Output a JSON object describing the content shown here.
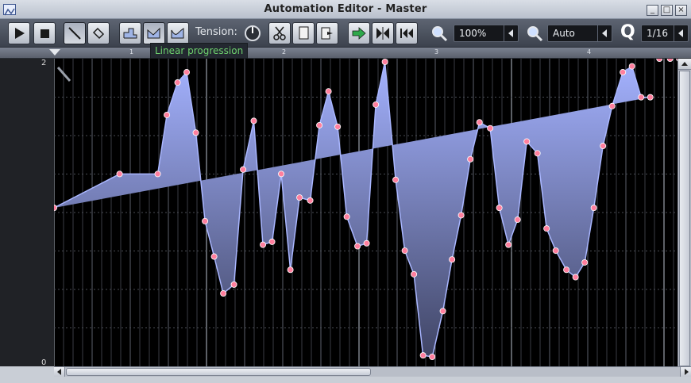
{
  "window": {
    "title": "Automation Editor - Master"
  },
  "toolbar": {
    "tension_label": "Tension:",
    "zoom_x": "100%",
    "zoom_y": "Auto",
    "quantization": "1/16",
    "quantization_icon_label": "Q",
    "buttons": [
      "play-icon",
      "stop-icon",
      "pencil-icon",
      "eraser-icon",
      "discrete-progression-icon",
      "linear-progression-icon",
      "cubic-hermite-progression-icon",
      "tension-knob-icon",
      "cut-icon",
      "copy-icon",
      "paste-icon",
      "playback-arrow-icon",
      "flip-icon",
      "rewind-icon",
      "zoom-x-icon",
      "zoom-y-icon"
    ]
  },
  "tooltip": {
    "text": "Linear progression"
  },
  "ruler": {
    "bars": [
      "1",
      "2",
      "3",
      "4"
    ]
  },
  "scale": {
    "max": "2",
    "min": "0"
  },
  "colors": {
    "background": "#000000",
    "fill_top": "#a4b2ff",
    "fill_bottom": "#404565",
    "line": "#a9b6ff",
    "point": "#ff7f9e"
  },
  "chart_data": {
    "type": "area",
    "xlabel": "",
    "ylabel": "",
    "ylim": [
      0,
      2
    ],
    "x": [
      0.0,
      0.43,
      0.68,
      0.74,
      0.81,
      0.87,
      0.93,
      0.99,
      1.05,
      1.11,
      1.18,
      1.24,
      1.31,
      1.37,
      1.43,
      1.49,
      1.55,
      1.61,
      1.68,
      1.74,
      1.8,
      1.86,
      1.92,
      1.99,
      2.05,
      2.11,
      2.17,
      2.24,
      2.3,
      2.36,
      2.42,
      2.48,
      2.55,
      2.61,
      2.67,
      2.73,
      2.79,
      2.86,
      2.92,
      2.98,
      3.04,
      3.1,
      3.17,
      3.23,
      3.29,
      3.36,
      3.42,
      3.48,
      3.54,
      3.6,
      3.66,
      3.73,
      3.79,
      3.85,
      3.91,
      3.97,
      4.04,
      4.1,
      4.16,
      4.22,
      4.28,
      4.35,
      4.41
    ],
    "values": [
      1.01,
      1.24,
      1.24,
      1.64,
      1.86,
      1.93,
      1.52,
      0.92,
      0.68,
      0.43,
      0.49,
      1.27,
      1.6,
      0.76,
      0.78,
      1.24,
      0.59,
      1.08,
      1.06,
      1.57,
      1.8,
      1.56,
      0.95,
      0.75,
      0.77,
      1.71,
      2.0,
      1.2,
      0.72,
      0.56,
      0.01,
      0.0,
      0.31,
      0.66,
      0.96,
      1.34,
      1.59,
      1.55,
      1.01,
      0.76,
      0.93,
      1.46,
      1.38,
      0.87,
      0.72,
      0.59,
      0.54,
      0.64,
      1.01,
      1.43,
      1.7,
      1.93,
      1.97,
      1.76,
      1.76
    ]
  }
}
